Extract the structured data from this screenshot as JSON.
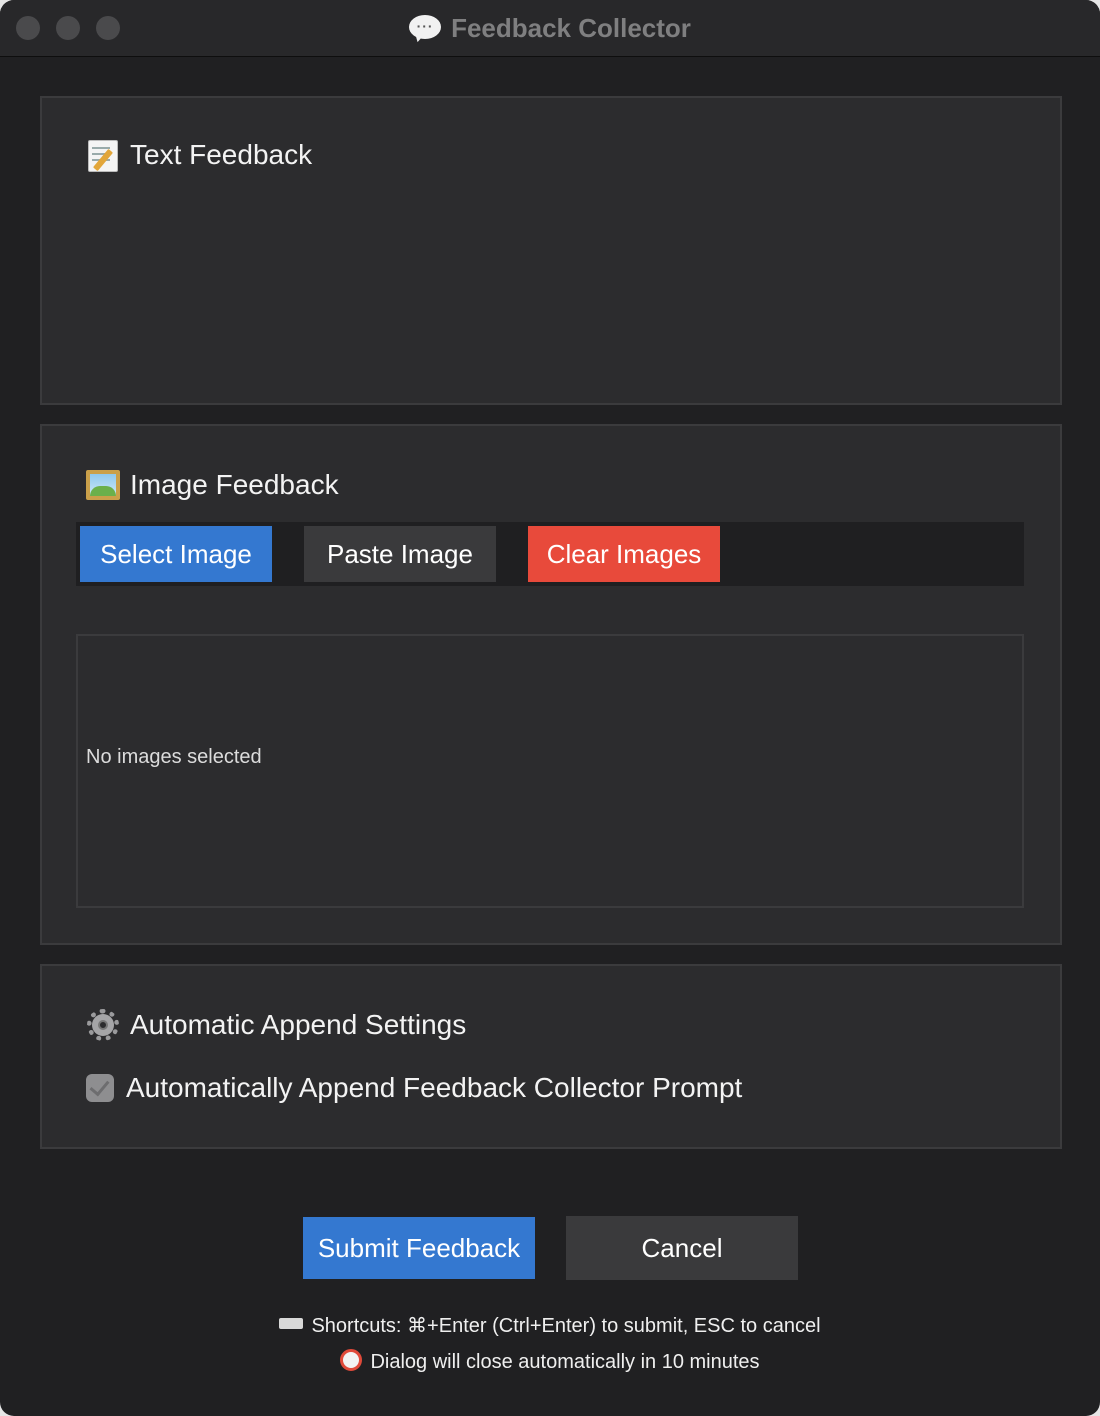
{
  "window": {
    "title": "Feedback Collector"
  },
  "text_feedback": {
    "title": "Text Feedback",
    "icon": "memo-icon"
  },
  "image_feedback": {
    "title": "Image Feedback",
    "icon": "framed-picture-icon",
    "buttons": {
      "select": "Select Image",
      "paste": "Paste Image",
      "clear": "Clear Images"
    },
    "empty_text": "No images selected"
  },
  "settings": {
    "title": "Automatic Append Settings",
    "icon": "gear-icon",
    "checkbox_label": "Automatically Append Feedback Collector Prompt",
    "checkbox_checked": true
  },
  "actions": {
    "submit": "Submit Feedback",
    "cancel": "Cancel"
  },
  "footer": {
    "shortcuts": "Shortcuts: ⌘+Enter (Ctrl+Enter) to submit, ESC to cancel",
    "timeout": "Dialog will close automatically in 10 minutes"
  },
  "colors": {
    "accent_blue": "#3478d0",
    "danger_red": "#e84a3b",
    "neutral_button": "#3a3a3c",
    "panel": "#2c2c2e",
    "background": "#202022"
  }
}
